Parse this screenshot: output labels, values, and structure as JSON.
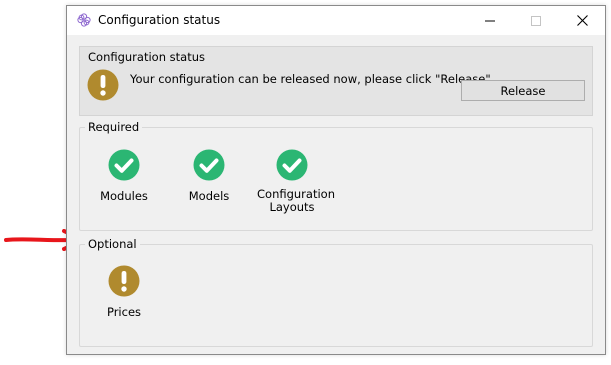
{
  "window": {
    "title": "Configuration status"
  },
  "status": {
    "legend": "Configuration status",
    "icon": "warning-exclamation-icon",
    "message": "Your configuration can be released now, please click \"Release\"",
    "release_label": "Release"
  },
  "required": {
    "legend": "Required",
    "items": [
      {
        "label": "Modules",
        "icon": "check-circle-icon",
        "state": "ok"
      },
      {
        "label": "Models",
        "icon": "check-circle-icon",
        "state": "ok"
      },
      {
        "label": "Configuration Layouts",
        "icon": "check-circle-icon",
        "state": "ok"
      }
    ]
  },
  "optional": {
    "legend": "Optional",
    "items": [
      {
        "label": "Prices",
        "icon": "warning-exclamation-icon",
        "state": "warning"
      }
    ]
  },
  "annotation": {
    "arrow_color": "#e8161b"
  },
  "colors": {
    "ok_green": "#2bb673",
    "warning_gold": "#b08a2e",
    "window_bg": "#f0f0f0"
  }
}
